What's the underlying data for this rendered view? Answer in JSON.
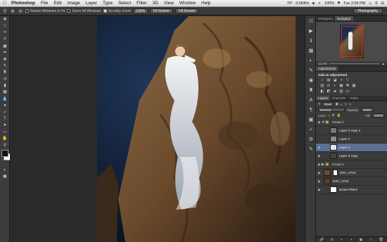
{
  "menubar": {
    "apple": "",
    "app_name": "Photoshop",
    "items": [
      "File",
      "Edit",
      "Image",
      "Layer",
      "Type",
      "Select",
      "Filter",
      "3D",
      "View",
      "Window",
      "Help"
    ],
    "status": {
      "temp": "76°",
      "speed": "0.0KB/s",
      "battery": "100%",
      "time": "Tue 2:56 PM"
    }
  },
  "options_bar": {
    "resize_windows": "Resize Windows to Fit",
    "zoom_all": "Zoom All Windows",
    "scrubby_zoom": "Scrubby Zoom",
    "zoom_value": "100%",
    "fit_screen": "Fit Screen",
    "fill_screen": "Fill Screen",
    "workspace": "Photography"
  },
  "navigator": {
    "tabs": [
      "Histogram",
      "Navigator"
    ],
    "active_tab": "Navigator",
    "zoom": "12.5%"
  },
  "adjustments": {
    "tab": "Adjustments",
    "title": "Add an adjustment",
    "row1": [
      "☼",
      "▤",
      "◪",
      "◑",
      "▽"
    ],
    "row2": [
      "▥",
      "⚖",
      "◐",
      "▦",
      "❋",
      "▩"
    ],
    "row3": [
      "◧",
      "◩",
      "▰",
      "▨",
      "▭"
    ]
  },
  "layers": {
    "tabs": [
      "Layers",
      "Channels",
      "Paths"
    ],
    "active_tab": "Layers",
    "kind": "Kind",
    "blend": "Normal",
    "opacity_label": "Opacity:",
    "opacity": "100%",
    "lock_label": "Lock:",
    "fill_label": "Fill:",
    "fill": "100%",
    "items": [
      {
        "name": "Group 2",
        "type": "group"
      },
      {
        "name": "Layer 3 copy 2",
        "type": "layer"
      },
      {
        "name": "Layer 2",
        "type": "layer"
      },
      {
        "name": "Layer 4",
        "type": "layer",
        "selected": true
      },
      {
        "name": "Layer 3 copy",
        "type": "layer"
      },
      {
        "name": "Group 1",
        "type": "group"
      },
      {
        "name": "DSC_0723",
        "type": "layer"
      },
      {
        "name": "DSC_0724",
        "type": "layer"
      },
      {
        "name": "Smart Filters",
        "type": "sub"
      }
    ]
  },
  "colors": {
    "accent": "#5a6f93",
    "panel": "#3b3b3b",
    "sky": "#0f1a2c",
    "rock": "#6b4a2c"
  }
}
